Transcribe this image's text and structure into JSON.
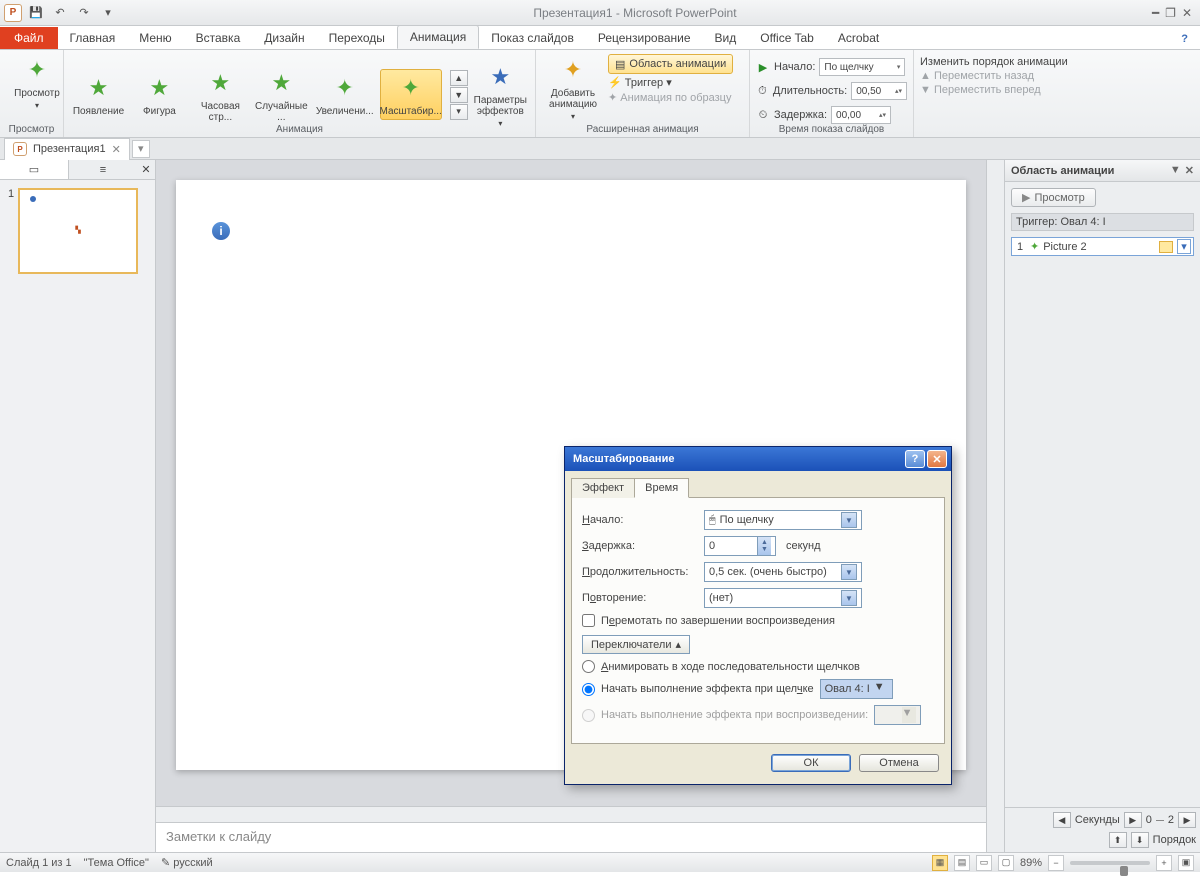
{
  "app_title": "Презентация1 - Microsoft PowerPoint",
  "file_tab": "Файл",
  "tabs": [
    "Главная",
    "Меню",
    "Вставка",
    "Дизайн",
    "Переходы",
    "Анимация",
    "Показ слайдов",
    "Рецензирование",
    "Вид",
    "Office Tab",
    "Acrobat"
  ],
  "active_tab": 5,
  "ribbon": {
    "preview_group": "Просмотр",
    "preview_btn": "Просмотр",
    "anim_group": "Анимация",
    "effects": [
      "Появление",
      "Фигура",
      "Часовая стр...",
      "Случайные ...",
      "Увеличени...",
      "Масштабир..."
    ],
    "selected_effect": 5,
    "params": "Параметры эффектов",
    "adv_group": "Расширенная анимация",
    "add_anim": "Добавить анимацию",
    "anim_pane": "Область анимации",
    "trigger": "Триггер",
    "by_sample": "Анимация по образцу",
    "timing_group": "Время показа слайдов",
    "start_lbl": "Начало:",
    "start_val": "По щелчку",
    "dur_lbl": "Длительность:",
    "dur_val": "00,50",
    "delay_lbl": "Задержка:",
    "delay_val": "00,00",
    "reorder_title": "Изменить порядок анимации",
    "move_back": "Переместить назад",
    "move_fwd": "Переместить вперед"
  },
  "doctab": "Презентация1",
  "pane": {
    "title": "Область анимации",
    "play": "Просмотр",
    "trigger": "Триггер: Овал 4: I",
    "item_idx": "1",
    "item_name": "Picture 2",
    "seconds": "Секунды",
    "sec_a": "0",
    "sec_b": "2",
    "order": "Порядок"
  },
  "notes": "Заметки к слайду",
  "dialog": {
    "title": "Масштабирование",
    "tab_effect": "Эффект",
    "tab_time": "Время",
    "start_lbl": "Начало:",
    "start_val": "По щелчку",
    "delay_lbl": "Задержка:",
    "delay_val": "0",
    "delay_unit": "секунд",
    "dur_lbl": "Продолжительность:",
    "dur_val": "0,5 сек. (очень быстро)",
    "repeat_lbl": "Повторение:",
    "repeat_val": "(нет)",
    "rewind": "Перемотать по завершении воспроизведения",
    "triggers_btn": "Переключатели",
    "r1": "Анимировать в ходе последовательности щелчков",
    "r2": "Начать выполнение эффекта при щелчке",
    "r2_val": "Овал 4: I",
    "r3": "Начать выполнение эффекта при воспроизведении:",
    "ok": "ОК",
    "cancel": "Отмена"
  },
  "status": {
    "slide": "Слайд 1 из 1",
    "theme": "\"Тема Office\"",
    "lang": "русский",
    "zoom": "89%"
  }
}
